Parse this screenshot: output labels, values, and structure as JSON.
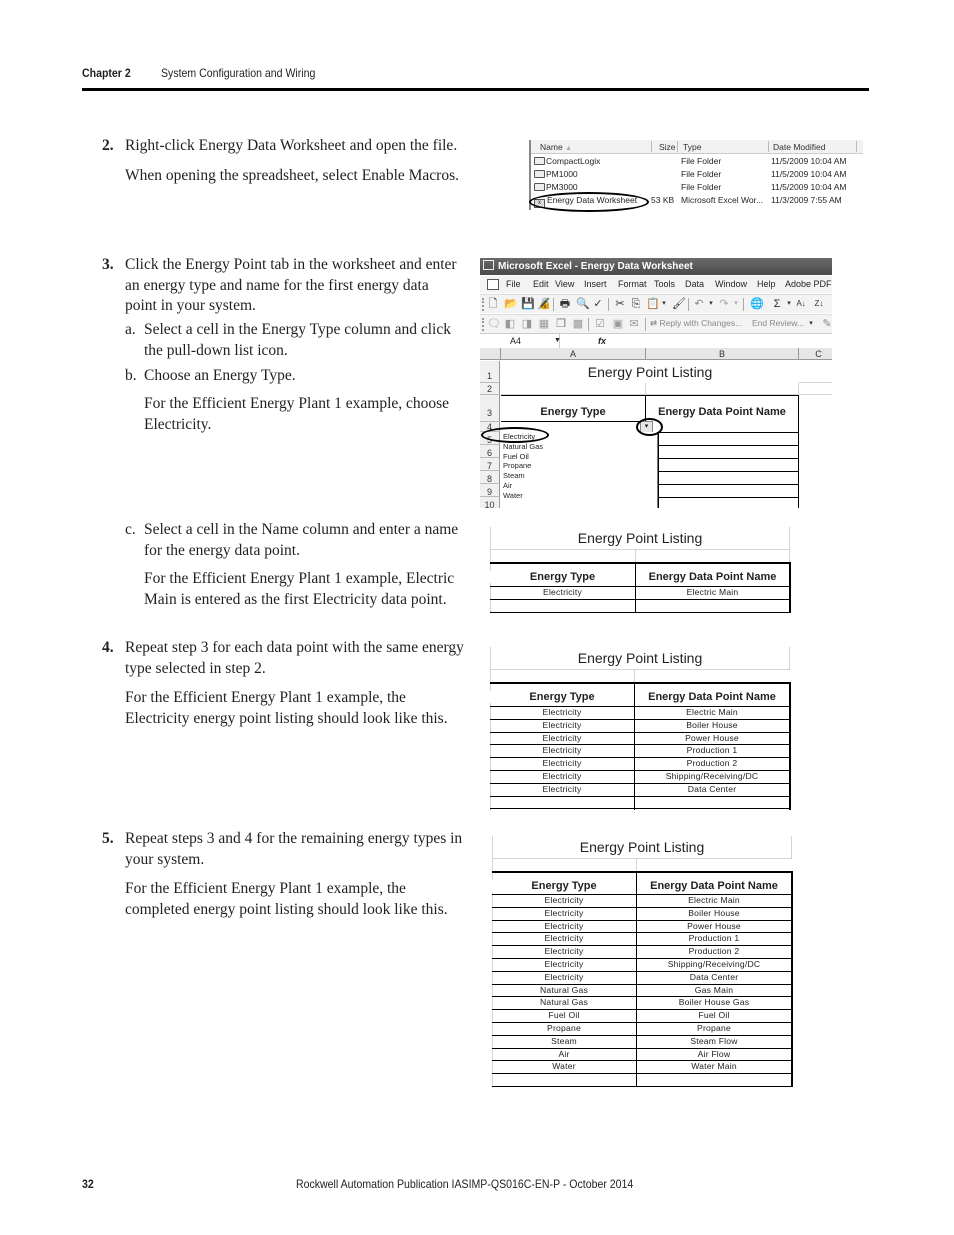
{
  "header": {
    "chapter": "Chapter 2",
    "section_title": "System Configuration and Wiring"
  },
  "steps": {
    "s2": {
      "number": "2.",
      "text": "Right-click Energy Data Worksheet and open the file.",
      "note": "When opening the spreadsheet, select Enable Macros."
    },
    "s3": {
      "number": "3.",
      "lines": [
        "Click the Energy Point tab in the worksheet and enter",
        "an energy type and name for the first energy data",
        "point in your system."
      ],
      "a_label": "a.",
      "a_lines": [
        "Select a cell in the Energy Type column and click",
        "the pull-down list icon."
      ],
      "b_label": "b.",
      "b_text": "Choose an Energy Type.",
      "b_note_lines": [
        "For the Efficient Energy Plant 1 example, choose",
        "Electricity."
      ],
      "c_label": "c.",
      "c_lines": [
        "Select a cell in the Name column and enter a name",
        "for the energy data point."
      ],
      "c_note_lines": [
        "For the Efficient Energy Plant 1 example, Electric",
        "Main is entered as the first Electricity data point."
      ]
    },
    "s4": {
      "number": "4.",
      "lines": [
        "Repeat step 3 for each data point with the same energy",
        "type selected in step 2."
      ],
      "note_lines": [
        "For the Efficient Energy Plant 1 example, the",
        "Electricity energy point listing should look like this."
      ]
    },
    "s5": {
      "number": "5.",
      "lines": [
        "Repeat steps 3 and 4 for the remaining energy types in",
        "your system."
      ],
      "note_lines": [
        "For the Efficient Energy Plant 1 example, the",
        "completed energy point listing should look like this."
      ]
    }
  },
  "explorer": {
    "columns": [
      "Name",
      "Size",
      "Type",
      "Date Modified"
    ],
    "sort_icon": "sort-ascending-icon",
    "files": [
      {
        "icon": "folder-icon",
        "name": "CompactLogix",
        "size": "",
        "type": "File Folder",
        "date": "11/5/2009 10:04 AM"
      },
      {
        "icon": "folder-icon",
        "name": "PM1000",
        "size": "",
        "type": "File Folder",
        "date": "11/5/2009 10:04 AM"
      },
      {
        "icon": "folder-icon",
        "name": "PM3000",
        "size": "",
        "type": "File Folder",
        "date": "11/5/2009 10:04 AM"
      },
      {
        "icon": "excel-file-icon",
        "name": "Energy Data Worksheet",
        "size": "53 KB",
        "type": "Microsoft Excel Wor...",
        "date": "11/3/2009 7:55 AM"
      }
    ]
  },
  "excel": {
    "title": "Microsoft Excel - Energy Data Worksheet",
    "menu": [
      "File",
      "Edit",
      "View",
      "Insert",
      "Format",
      "Tools",
      "Data",
      "Window",
      "Help",
      "Adobe PDF"
    ],
    "toolbar_reviewing": {
      "reply": "Reply with Changes...",
      "end_review": "End Review..."
    },
    "name_box": "A4",
    "fx": "fx",
    "columns": [
      "A",
      "B",
      "C"
    ],
    "rows": [
      "1",
      "2",
      "3",
      "4",
      "5",
      "6",
      "7",
      "8",
      "9",
      "10"
    ],
    "sheet_title": "Energy Point Listing",
    "col_a_header": "Energy Type",
    "col_b_header": "Energy Data Point Name",
    "dropdown_options": [
      "Electricity",
      "Natural Gas",
      "Fuel Oil",
      "Propane",
      "Steam",
      "Air",
      "Water"
    ],
    "dropdown_arrow": "▾"
  },
  "listing1": {
    "title": "Energy Point Listing",
    "headers": [
      "Energy Type",
      "Energy Data Point Name"
    ],
    "rows": [
      [
        "Electricity",
        "Electric Main"
      ]
    ]
  },
  "listing2": {
    "title": "Energy Point Listing",
    "headers": [
      "Energy Type",
      "Energy Data Point Name"
    ],
    "rows": [
      [
        "Electricity",
        "Electric Main"
      ],
      [
        "Electricity",
        "Boiler House"
      ],
      [
        "Electricity",
        "Power House"
      ],
      [
        "Electricity",
        "Production 1"
      ],
      [
        "Electricity",
        "Production 2"
      ],
      [
        "Electricity",
        "Shipping/Receiving/DC"
      ],
      [
        "Electricity",
        "Data Center"
      ]
    ]
  },
  "listing3": {
    "title": "Energy Point Listing",
    "headers": [
      "Energy Type",
      "Energy Data Point Name"
    ],
    "rows": [
      [
        "Electricity",
        "Electric Main"
      ],
      [
        "Electricity",
        "Boiler House"
      ],
      [
        "Electricity",
        "Power House"
      ],
      [
        "Electricity",
        "Production 1"
      ],
      [
        "Electricity",
        "Production 2"
      ],
      [
        "Electricity",
        "Shipping/Receiving/DC"
      ],
      [
        "Electricity",
        "Data Center"
      ],
      [
        "Natural Gas",
        "Gas Main"
      ],
      [
        "Natural Gas",
        "Boiler House Gas"
      ],
      [
        "Fuel Oil",
        "Fuel Oil"
      ],
      [
        "Propane",
        "Propane"
      ],
      [
        "Steam",
        "Steam Flow"
      ],
      [
        "Air",
        "Air Flow"
      ],
      [
        "Water",
        "Water Main"
      ]
    ]
  },
  "footer": {
    "page_number": "32",
    "publication": "Rockwell Automation Publication IASIMP-QS016C-EN-P - October 2014"
  }
}
